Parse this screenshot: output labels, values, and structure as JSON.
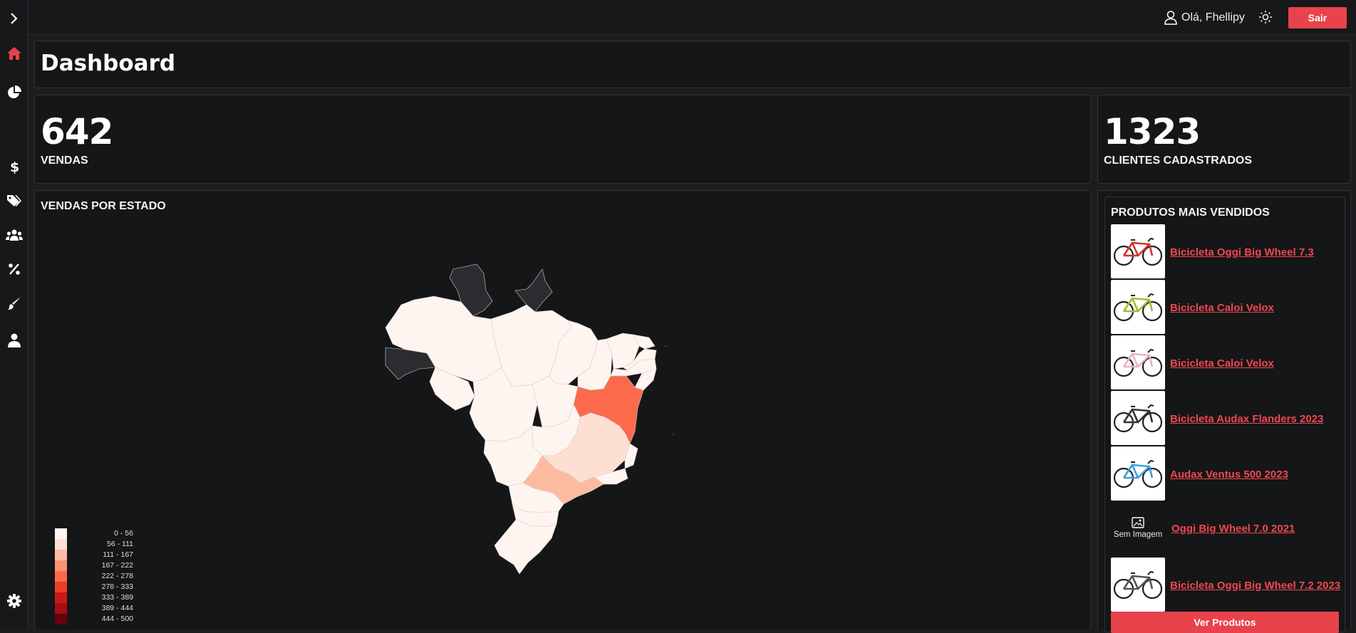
{
  "header": {
    "greeting": "Olá, Fhellipy",
    "logout_label": "Sair"
  },
  "sidebar": {
    "items": [
      {
        "name": "expand",
        "icon": "chevron-right-icon"
      },
      {
        "name": "home",
        "icon": "home-icon",
        "active": true
      },
      {
        "name": "charts",
        "icon": "pie-chart-icon"
      },
      {
        "name": "sales",
        "icon": "dollar-icon"
      },
      {
        "name": "products",
        "icon": "tags-icon"
      },
      {
        "name": "customers",
        "icon": "users-icon"
      },
      {
        "name": "discounts",
        "icon": "percent-icon"
      },
      {
        "name": "themes",
        "icon": "paint-brush-icon"
      },
      {
        "name": "account",
        "icon": "user-icon"
      },
      {
        "name": "settings",
        "icon": "gear-icon"
      }
    ]
  },
  "page": {
    "title": "Dashboard"
  },
  "stats": {
    "sales_count": "642",
    "sales_label": "VENDAS",
    "clients_count": "1323",
    "clients_label": "CLIENTES CADASTRADOS"
  },
  "map": {
    "title": "VENDAS POR ESTADO",
    "legend": [
      {
        "label": "0 - 56",
        "color": "#fff5f0"
      },
      {
        "label": "56 - 111",
        "color": "#fde0d2"
      },
      {
        "label": "111 - 167",
        "color": "#fcbba1"
      },
      {
        "label": "167 - 222",
        "color": "#fc9272"
      },
      {
        "label": "222 - 278",
        "color": "#fb6a4a"
      },
      {
        "label": "278 - 333",
        "color": "#ef3b2c"
      },
      {
        "label": "333 - 389",
        "color": "#cb181d"
      },
      {
        "label": "389 - 444",
        "color": "#a50f15"
      },
      {
        "label": "444 - 500",
        "color": "#67000d"
      }
    ]
  },
  "products": {
    "title": "PRODUTOS MAIS VENDIDOS",
    "no_image_label": "Sem Imagem",
    "view_all_label": "Ver Produtos",
    "items": [
      {
        "name": "Bicicleta Oggi Big Wheel 7.3",
        "frame_color": "#d3332b",
        "has_image": true
      },
      {
        "name": "Bicicleta Caloi Velox",
        "frame_color": "#9bbf2f",
        "has_image": true
      },
      {
        "name": "Bicicleta Caloi Velox",
        "frame_color": "#e9b3c0",
        "has_image": true
      },
      {
        "name": "Bicicleta Audax Flanders 2023",
        "frame_color": "#333333",
        "has_image": true
      },
      {
        "name": "Audax Ventus 500 2023",
        "frame_color": "#3f9fd8",
        "has_image": true
      },
      {
        "name": "Oggi Big Wheel 7.0 2021",
        "frame_color": "",
        "has_image": false
      },
      {
        "name": "Bicicleta Oggi Big Wheel 7.2 2023",
        "frame_color": "#555555",
        "has_image": true
      }
    ]
  },
  "colors": {
    "accent": "#e8434b",
    "background": "#1c1d1f",
    "card": "#151618",
    "map_empty": "#2a2c30"
  }
}
